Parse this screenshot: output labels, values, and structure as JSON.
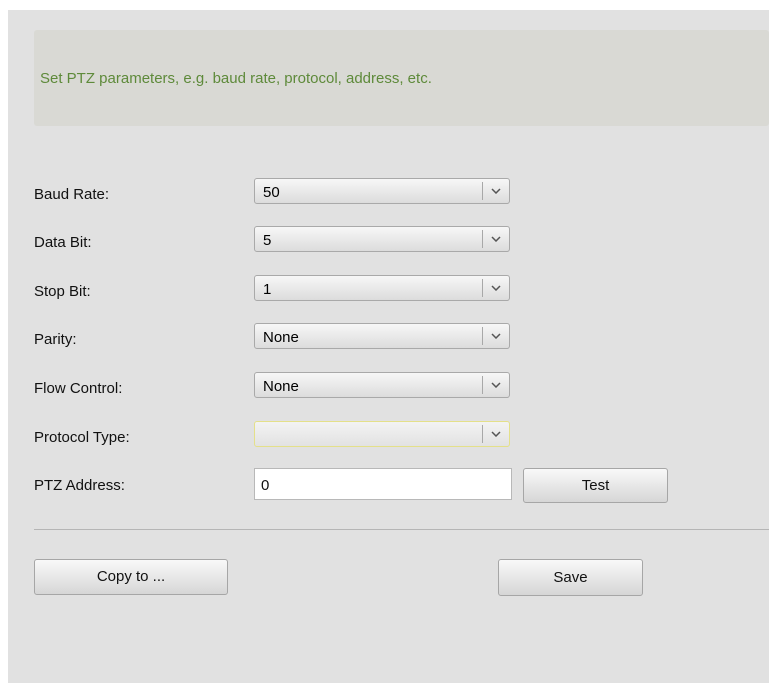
{
  "description": "Set PTZ parameters, e.g. baud rate, protocol, address, etc.",
  "fields": {
    "baud_rate": {
      "label": "Baud Rate:",
      "value": "50"
    },
    "data_bit": {
      "label": "Data Bit:",
      "value": "5"
    },
    "stop_bit": {
      "label": "Stop Bit:",
      "value": "1"
    },
    "parity": {
      "label": "Parity:",
      "value": "None"
    },
    "flow_control": {
      "label": "Flow Control:",
      "value": "None"
    },
    "protocol_type": {
      "label": "Protocol Type:",
      "value": ""
    },
    "ptz_address": {
      "label": "PTZ Address:",
      "value": "0"
    }
  },
  "buttons": {
    "test": "Test",
    "copy_to": "Copy to ...",
    "save": "Save"
  },
  "icons": {
    "dropdown": "chevron-down-icon"
  }
}
